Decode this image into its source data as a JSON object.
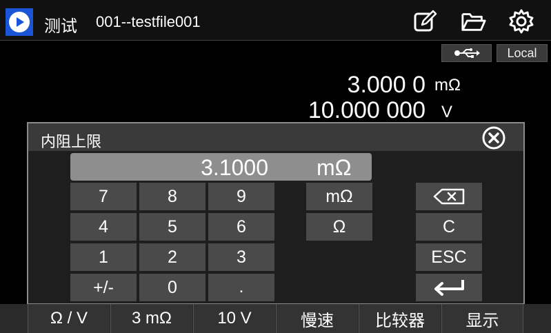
{
  "header": {
    "title": "测试",
    "file_name": "001--testfile001",
    "icons": [
      "play-icon",
      "edit-icon",
      "folder-icon",
      "settings-icon"
    ]
  },
  "status": {
    "usb_icon": "usb-icon",
    "mode": "Local"
  },
  "readings": {
    "resistance_value": "3.000 0",
    "resistance_unit": "mΩ",
    "voltage_value": "10.000 000",
    "voltage_unit": "V"
  },
  "dialog": {
    "title": "内阻上限",
    "input_value": "3.1000",
    "input_unit": "mΩ",
    "keys": {
      "k7": "7",
      "k8": "8",
      "k9": "9",
      "k4": "4",
      "k5": "5",
      "k6": "6",
      "k1": "1",
      "k2": "2",
      "k3": "3",
      "sign": "+/-",
      "k0": "0",
      "dot": ".",
      "unit_mohm": "mΩ",
      "unit_ohm": "Ω",
      "clear": "C",
      "esc": "ESC"
    }
  },
  "bottom_tabs": [
    "Ω / V",
    "3 mΩ",
    "10 V",
    "慢速",
    "比较器",
    "显示"
  ],
  "colors": {
    "accent_blue": "#1a55d6",
    "key_bg": "#4a4a4a",
    "display_bg": "#8e8e8e"
  }
}
